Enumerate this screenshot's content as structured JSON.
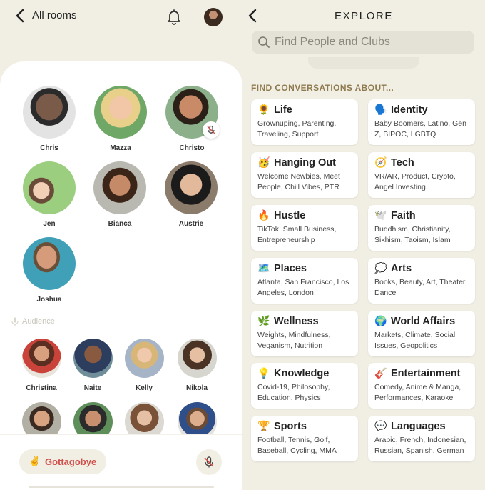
{
  "left": {
    "back_label": "All rooms",
    "speakers": [
      {
        "name": "Chris",
        "muted": false
      },
      {
        "name": "Mazza",
        "muted": false
      },
      {
        "name": "Christo",
        "muted": true
      },
      {
        "name": "Jen",
        "muted": false
      },
      {
        "name": "Bianca",
        "muted": false
      },
      {
        "name": "Austrie",
        "muted": false
      },
      {
        "name": "Joshua",
        "muted": false
      }
    ],
    "audience_label": "Audience",
    "audience": [
      {
        "name": "Christina"
      },
      {
        "name": "Naite"
      },
      {
        "name": "Kelly"
      },
      {
        "name": "Nikola"
      },
      {
        "name": ""
      },
      {
        "name": ""
      },
      {
        "name": ""
      },
      {
        "name": ""
      }
    ],
    "leave_label": "Gottagobye",
    "leave_emoji": "✌️"
  },
  "right": {
    "title": "EXPLORE",
    "search_placeholder": "Find People and Clubs",
    "section_title": "FIND CONVERSATIONS ABOUT...",
    "topics": [
      {
        "emoji": "🌻",
        "title": "Life",
        "subtitle": "Grownuping, Parenting, Traveling, Support"
      },
      {
        "emoji": "🗣️",
        "title": "Identity",
        "subtitle": "Baby Boomers, Latino, Gen Z, BIPOC, LGBTQ"
      },
      {
        "emoji": "🥳",
        "title": "Hanging Out",
        "subtitle": "Welcome Newbies, Meet People, Chill Vibes, PTR"
      },
      {
        "emoji": "🧭",
        "title": "Tech",
        "subtitle": "VR/AR, Product, Crypto, Angel Investing"
      },
      {
        "emoji": "🔥",
        "title": "Hustle",
        "subtitle": "TikTok, Small Business, Entrepreneurship"
      },
      {
        "emoji": "🕊️",
        "title": "Faith",
        "subtitle": "Buddhism, Christianity, Sikhism, Taoism, Islam"
      },
      {
        "emoji": "🗺️",
        "title": "Places",
        "subtitle": "Atlanta, San Francisco, Los Angeles, London"
      },
      {
        "emoji": "💭",
        "title": "Arts",
        "subtitle": "Books, Beauty, Art, Theater, Dance"
      },
      {
        "emoji": "🌿",
        "title": "Wellness",
        "subtitle": "Weights, Mindfulness, Veganism, Nutrition"
      },
      {
        "emoji": "🌍",
        "title": "World Affairs",
        "subtitle": "Markets, Climate, Social Issues, Geopolitics"
      },
      {
        "emoji": "💡",
        "title": "Knowledge",
        "subtitle": "Covid-19, Philosophy, Education, Physics"
      },
      {
        "emoji": "🎸",
        "title": "Entertainment",
        "subtitle": "Comedy, Anime & Manga, Performances, Karaoke"
      },
      {
        "emoji": "🏆",
        "title": "Sports",
        "subtitle": "Football, Tennis, Golf, Baseball, Cycling, MMA"
      },
      {
        "emoji": "💬",
        "title": "Languages",
        "subtitle": "Arabic, French, Indonesian, Russian, Spanish, German"
      }
    ]
  }
}
